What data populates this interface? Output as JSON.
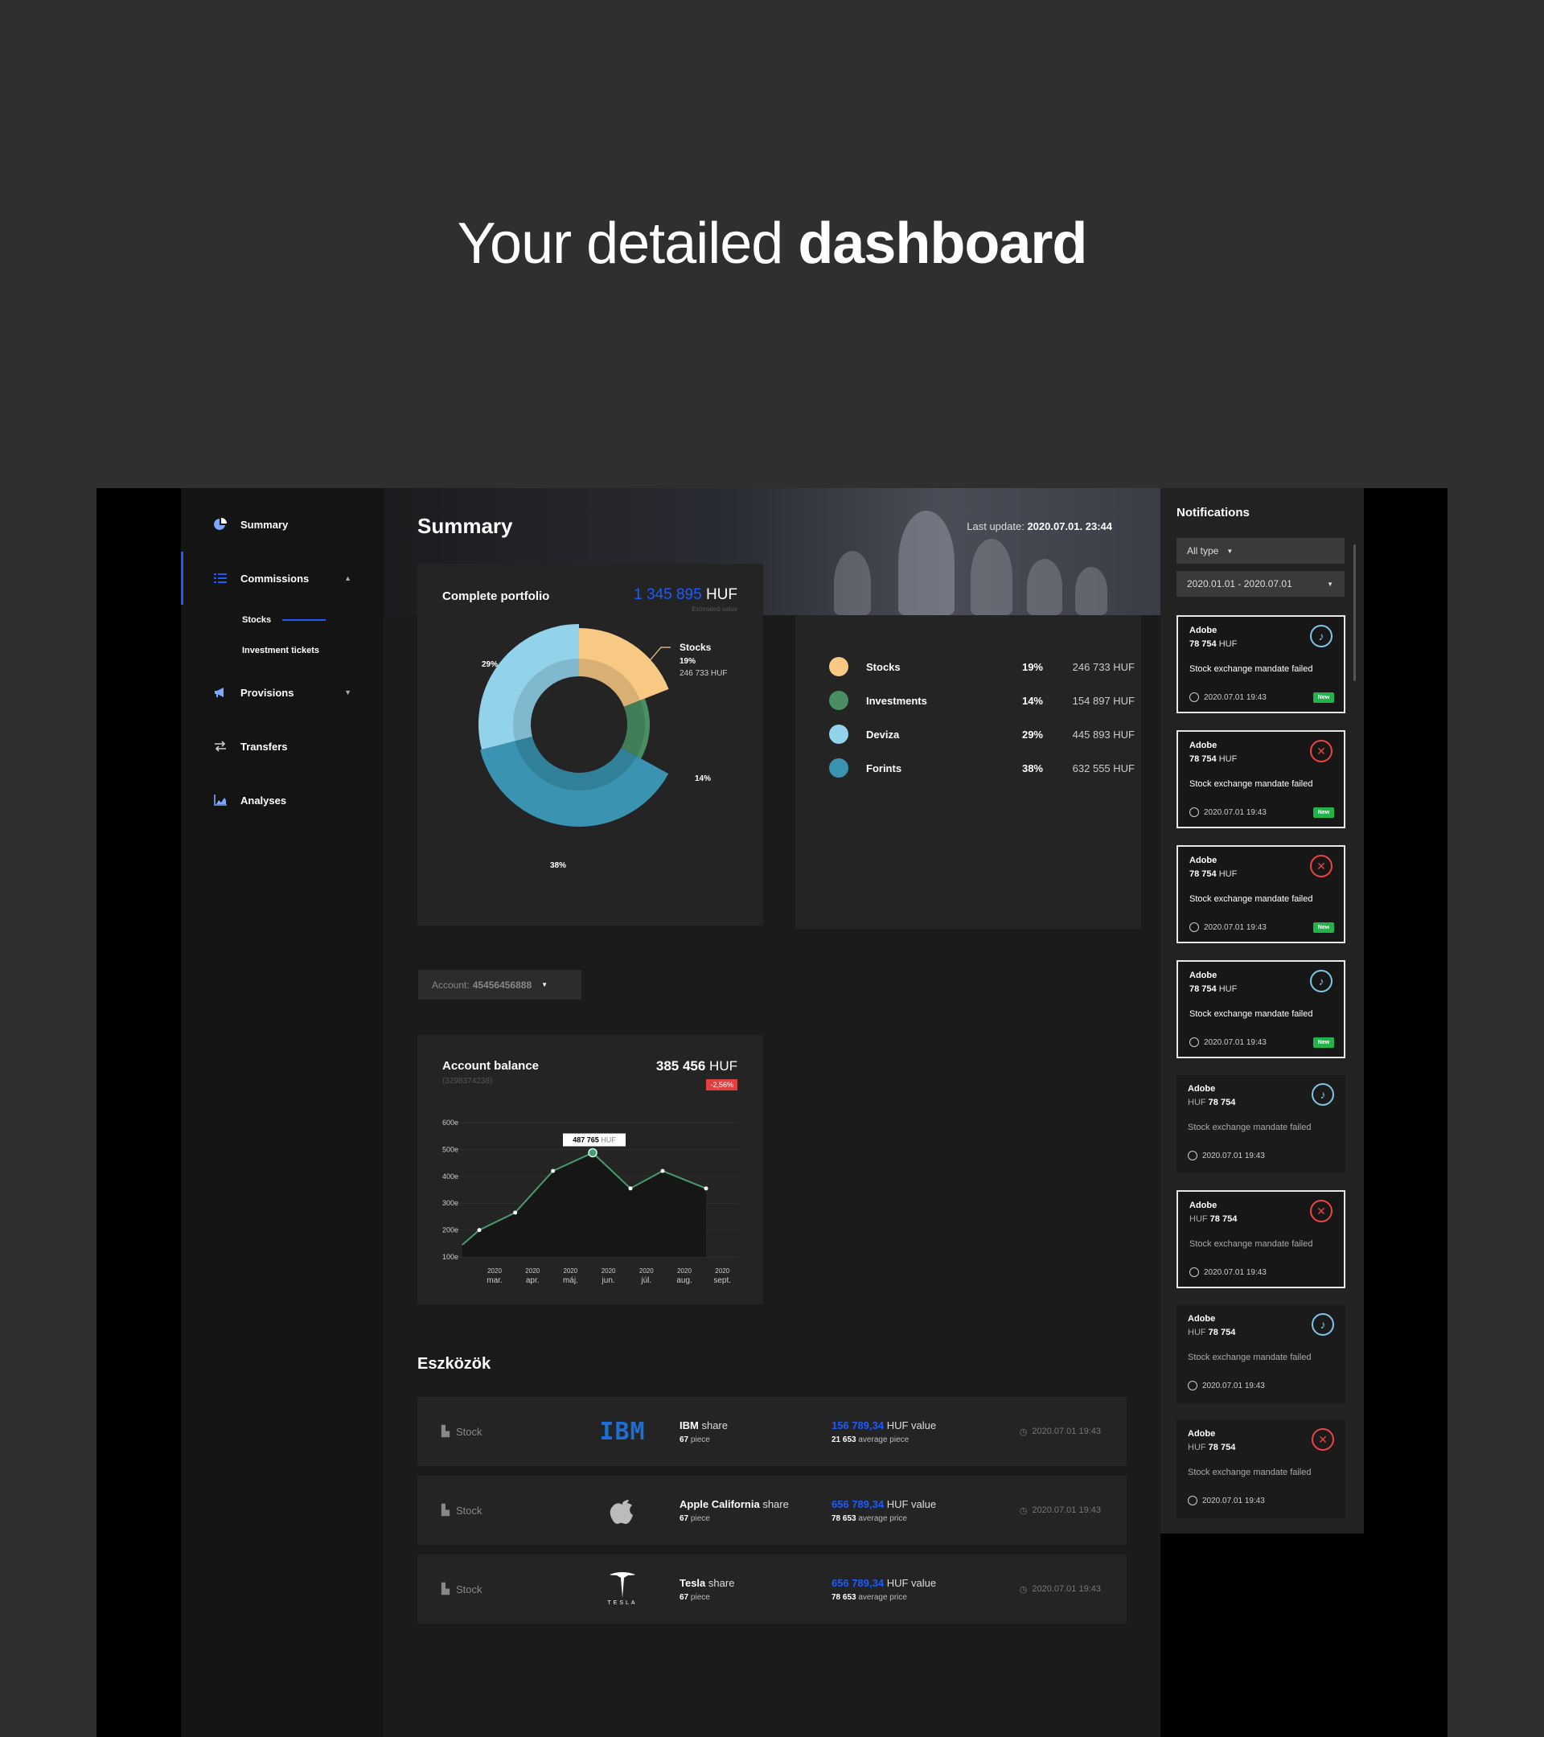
{
  "hero": {
    "title_regular": "Your detailed",
    "title_bold": "dashboard"
  },
  "sidebar": {
    "items": [
      {
        "label": "Summary",
        "icon": "pie-chart-icon"
      },
      {
        "label": "Commissions",
        "icon": "list-icon"
      },
      {
        "label": "Provisions",
        "icon": "megaphone-icon"
      },
      {
        "label": "Transfers",
        "icon": "transfer-arrows-icon"
      },
      {
        "label": "Analyses",
        "icon": "bar-chart-icon"
      }
    ],
    "subitems": [
      "Stocks",
      "Investment tickets"
    ]
  },
  "header": {
    "title": "Summary",
    "last_update_label": "Last update:",
    "last_update_value": "2020.07.01. 23:44"
  },
  "portfolio": {
    "title": "Complete portfolio",
    "amount": "1 345 895",
    "currency": "HUF",
    "caption": "Estimated value"
  },
  "chart_data": [
    {
      "type": "pie",
      "title": "Complete portfolio",
      "segments": [
        {
          "name": "Stocks",
          "percent": 19,
          "value": "246 733 HUF",
          "color": "#f7c983"
        },
        {
          "name": "Investments",
          "percent": 14,
          "value": "154 897 HUF",
          "color": "#4a8f63"
        },
        {
          "name": "Deviza",
          "percent": 29,
          "value": "445 893 HUF",
          "color": "#92d2ea"
        },
        {
          "name": "Forints",
          "percent": 38,
          "value": "632 555 HUF",
          "color": "#3993b1"
        }
      ],
      "callout": {
        "name": "Stocks",
        "percent": "19%",
        "value": "246 733 HUF"
      },
      "slice_labels": [
        "29%",
        "14%",
        "38%"
      ]
    },
    {
      "type": "line",
      "title": "Account balance",
      "x_year": "2020",
      "categories": [
        "mar.",
        "apr.",
        "máj.",
        "jun.",
        "júl.",
        "aug.",
        "sept."
      ],
      "yticks": [
        "600e",
        "500e",
        "400e",
        "300e",
        "200e",
        "100e"
      ],
      "ylim": [
        100,
        600
      ],
      "points": [
        {
          "x": 0.55,
          "y": 145
        },
        {
          "x": 1.0,
          "y": 200
        },
        {
          "x": 1.95,
          "y": 265
        },
        {
          "x": 2.95,
          "y": 420
        },
        {
          "x": 4.0,
          "y": 487.765
        },
        {
          "x": 5.0,
          "y": 355
        },
        {
          "x": 5.85,
          "y": 420
        },
        {
          "x": 7.0,
          "y": 355
        }
      ],
      "highlight": {
        "label": "487 765",
        "unit": "HUF"
      },
      "grid": true,
      "line_color": "#4a9a6b"
    }
  ],
  "account": {
    "label": "Account:",
    "number": "45456456888"
  },
  "balance": {
    "title": "Account balance",
    "subtitle": "(3298374238)",
    "amount": "385 456",
    "currency": "HUF",
    "change": "-2,56%"
  },
  "assets": {
    "title": "Eszközök",
    "rows": [
      {
        "type": "Stock",
        "company": "IBM",
        "share_word": "share",
        "pieces": "67",
        "piece_word": "piece",
        "value": "156 789,34",
        "value_word": "HUF value",
        "avg": "21 653",
        "avg_word": "average piece",
        "time": "2020.07.01  19:43",
        "logo": "ibm-logo"
      },
      {
        "type": "Stock",
        "company": "Apple California",
        "share_word": "share",
        "pieces": "67",
        "piece_word": "piece",
        "value": "656 789,34",
        "value_word": "HUF value",
        "avg": "78 653",
        "avg_word": "average price",
        "time": "2020.07.01  19:43",
        "logo": "apple-logo"
      },
      {
        "type": "Stock",
        "company": "Tesla",
        "share_word": "share",
        "pieces": "67",
        "piece_word": "piece",
        "value": "656 789,34",
        "value_word": "HUF value",
        "avg": "78 653",
        "avg_word": "average price",
        "time": "2020.07.01  19:43",
        "logo": "tesla-logo"
      }
    ]
  },
  "notifications": {
    "title": "Notifications",
    "filter_type": "All type",
    "filter_date": "2020.01.01 - 2020.07.01",
    "items": [
      {
        "company": "Adobe",
        "amount": "78 754",
        "currency": "HUF",
        "message": "Stock exchange mandate failed",
        "time": "2020.07.01  19:43",
        "status": "bell",
        "badge": "New"
      },
      {
        "company": "Adobe",
        "amount": "78 754",
        "currency": "HUF",
        "message": "Stock exchange mandate failed",
        "time": "2020.07.01  19:43",
        "status": "error",
        "badge": "New"
      },
      {
        "company": "Adobe",
        "amount": "78 754",
        "currency": "HUF",
        "message": "Stock exchange mandate failed",
        "time": "2020.07.01  19:43",
        "status": "error",
        "badge": "New"
      },
      {
        "company": "Adobe",
        "amount": "78 754",
        "currency": "HUF",
        "message": "Stock exchange mandate failed",
        "time": "2020.07.01  19:43",
        "status": "bell",
        "badge": "New"
      },
      {
        "company": "Adobe",
        "amount": "78 754",
        "currency": "HUF",
        "message": "Stock exchange mandate failed",
        "time": "2020.07.01  19:43",
        "status": "bell"
      },
      {
        "company": "Adobe",
        "amount": "78 754",
        "currency": "HUF",
        "message": "Stock exchange mandate failed",
        "time": "2020.07.01  19:43",
        "status": "error"
      },
      {
        "company": "Adobe",
        "amount": "78 754",
        "currency": "HUF",
        "message": "Stock exchange mandate failed",
        "time": "2020.07.01  19:43",
        "status": "bell"
      },
      {
        "company": "Adobe",
        "amount": "78 754",
        "currency": "HUF",
        "message": "Stock exchange mandate failed",
        "time": "2020.07.01  19:43",
        "status": "error"
      }
    ]
  },
  "colors": {
    "accent": "#1d5bff",
    "negative": "#e0403f",
    "positive": "#22b34a"
  }
}
